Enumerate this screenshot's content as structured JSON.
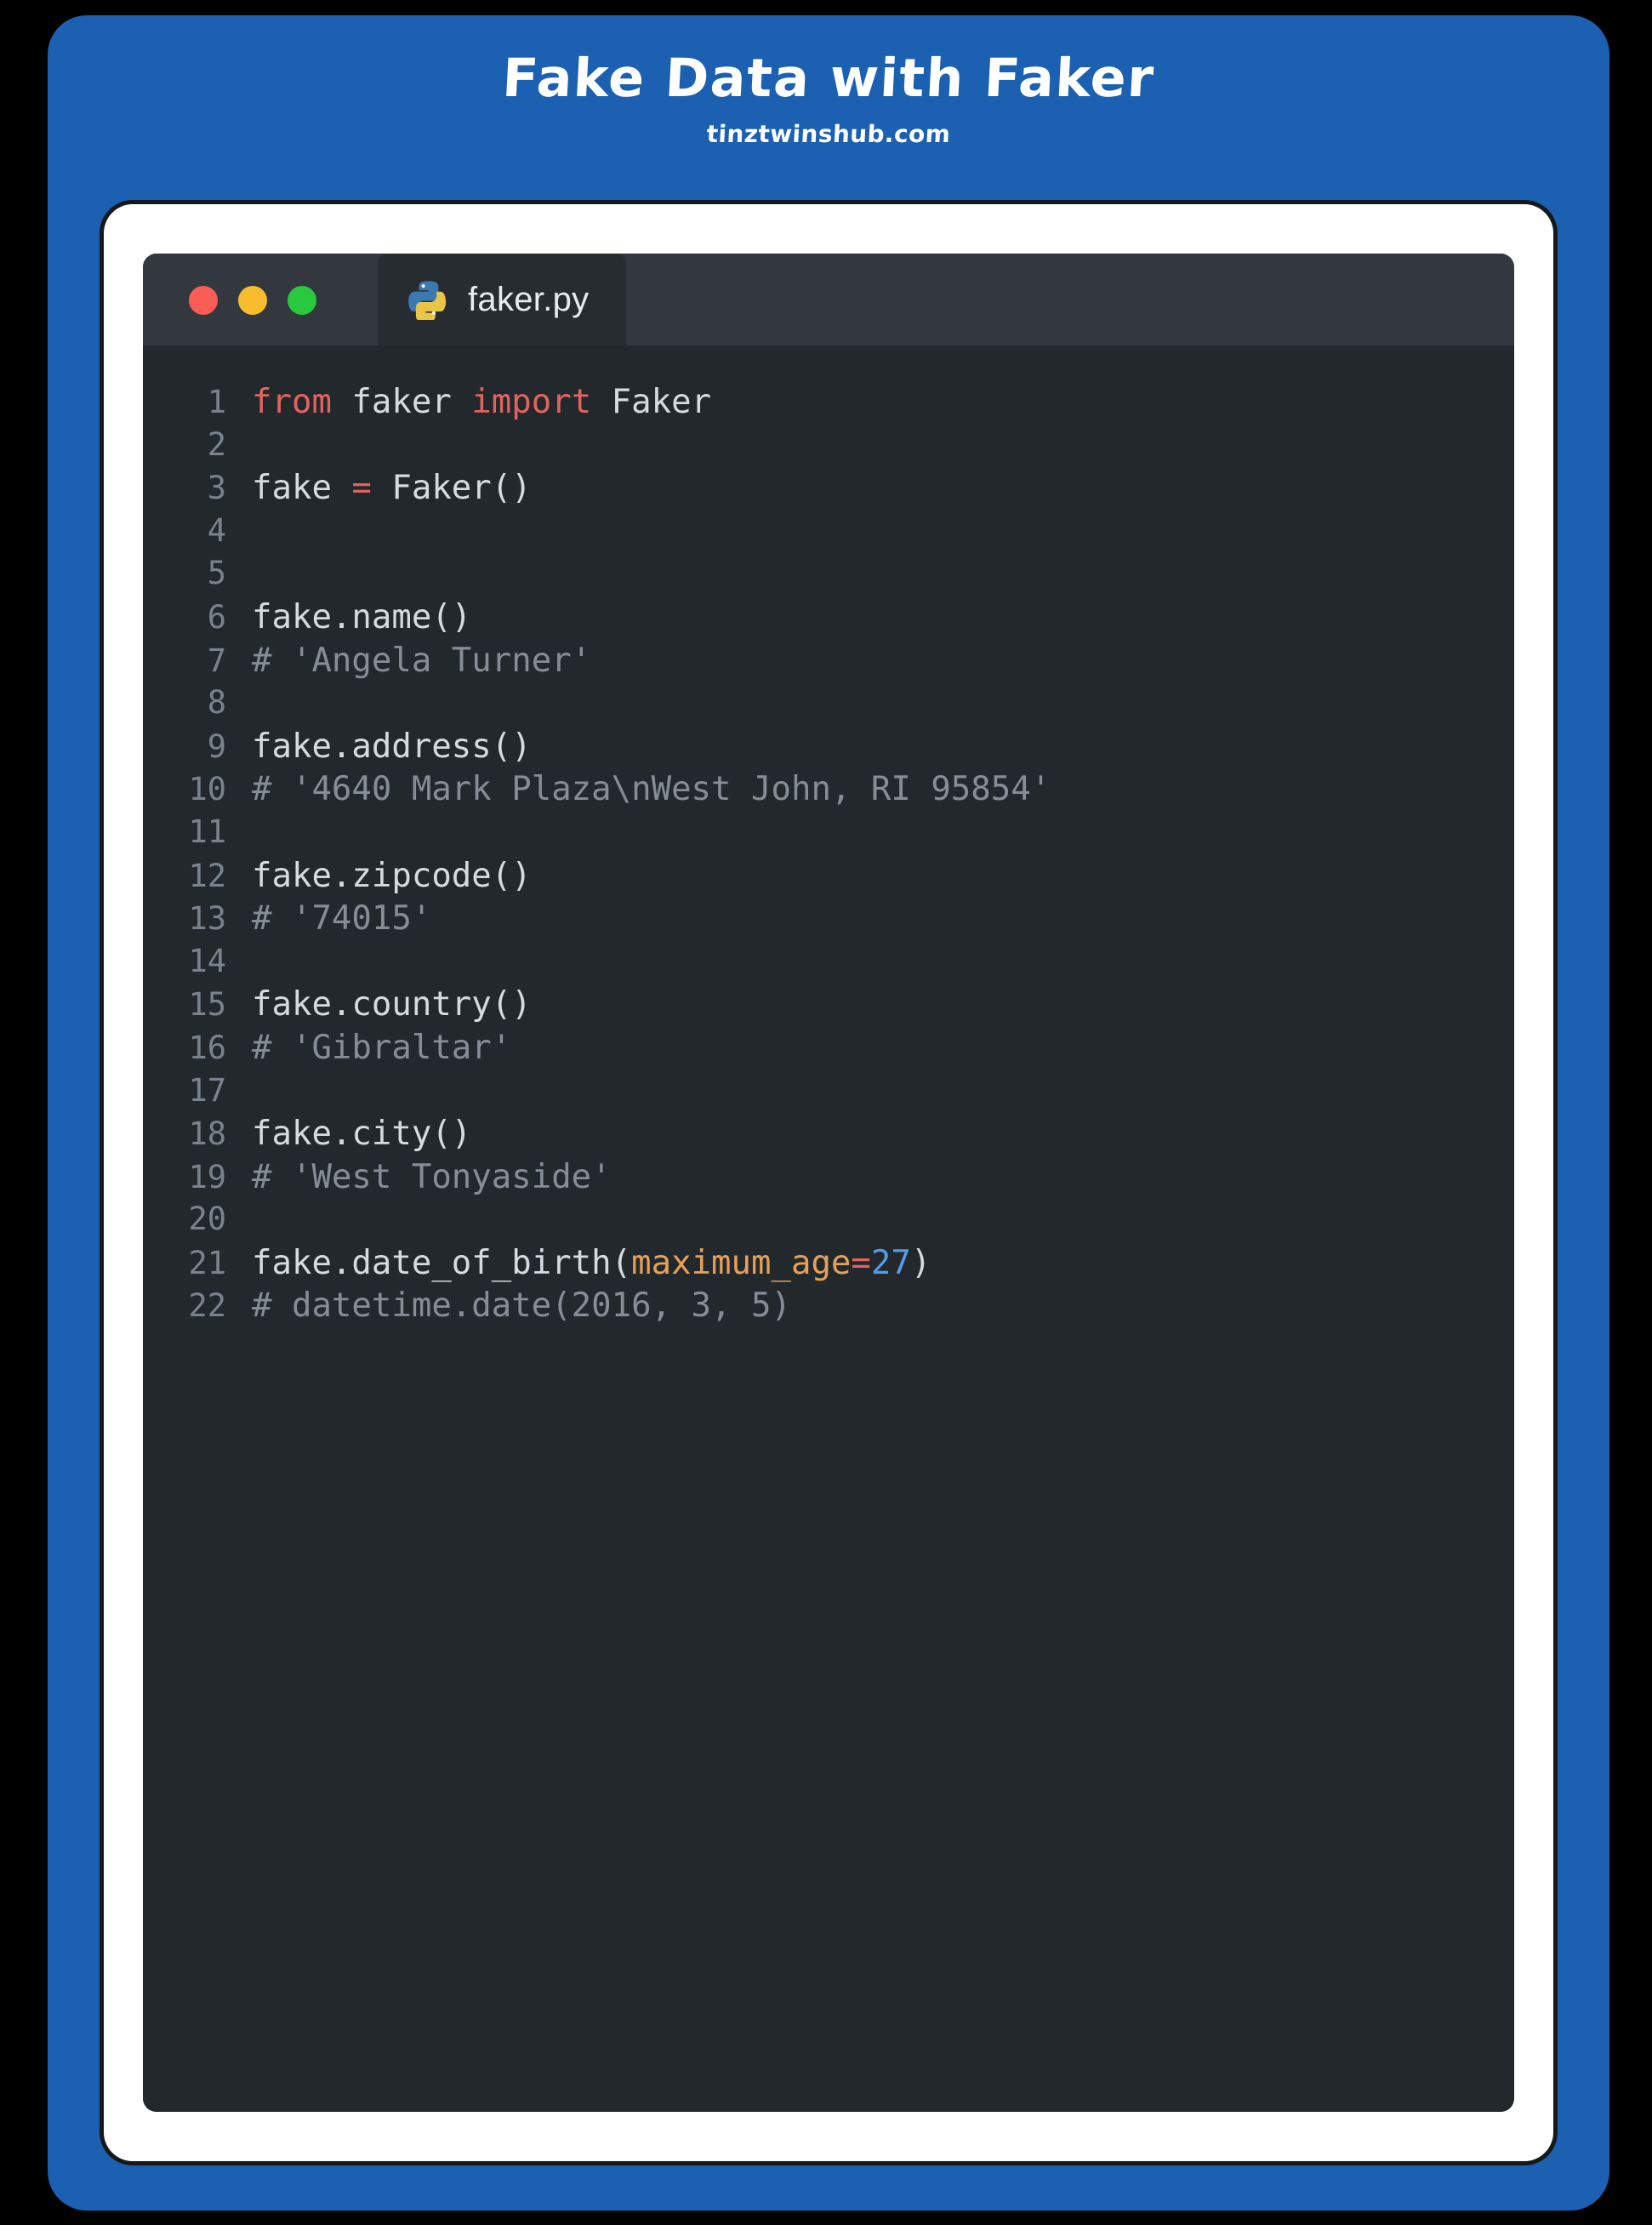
{
  "poster": {
    "title": "Fake Data with Faker",
    "subtitle": "tinztwinshub.com",
    "background_color": "#000000",
    "frame_color": "#1b60b1",
    "card_color": "#ffffff"
  },
  "window": {
    "titlebar_color": "#32383e",
    "body_color": "#23282c",
    "traffic_lights": [
      {
        "name": "close",
        "color": "#fa5d55"
      },
      {
        "name": "minimize",
        "color": "#f8bd2e"
      },
      {
        "name": "maximize",
        "color": "#28c83f"
      }
    ],
    "tab": {
      "label": "faker.py",
      "icon": "python-icon",
      "active": true
    }
  },
  "editor": {
    "language": "python",
    "syntax_colors": {
      "keyword": "#e0645f",
      "operator": "#e0645f",
      "comment": "#858e97",
      "kwarg": "#e6a158",
      "number": "#559bea",
      "plain": "#d6dbe0",
      "line_number": "#78838d"
    },
    "lines": [
      {
        "n": "1",
        "tokens": [
          {
            "t": "from",
            "c": "kw"
          },
          {
            "t": " faker ",
            "c": "plain"
          },
          {
            "t": "import",
            "c": "kw"
          },
          {
            "t": " Faker",
            "c": "plain"
          }
        ]
      },
      {
        "n": "2",
        "tokens": []
      },
      {
        "n": "3",
        "tokens": [
          {
            "t": "fake ",
            "c": "plain"
          },
          {
            "t": "=",
            "c": "op"
          },
          {
            "t": " Faker()",
            "c": "plain"
          }
        ]
      },
      {
        "n": "4",
        "tokens": []
      },
      {
        "n": "5",
        "tokens": []
      },
      {
        "n": "6",
        "tokens": [
          {
            "t": "fake.name()",
            "c": "plain"
          }
        ]
      },
      {
        "n": "7",
        "tokens": [
          {
            "t": "# 'Angela Turner'",
            "c": "comment"
          }
        ]
      },
      {
        "n": "8",
        "tokens": []
      },
      {
        "n": "9",
        "tokens": [
          {
            "t": "fake.address()",
            "c": "plain"
          }
        ]
      },
      {
        "n": "10",
        "tokens": [
          {
            "t": "# '4640 Mark Plaza\\nWest John, RI 95854'",
            "c": "comment"
          }
        ]
      },
      {
        "n": "11",
        "tokens": []
      },
      {
        "n": "12",
        "tokens": [
          {
            "t": "fake.zipcode()",
            "c": "plain"
          }
        ]
      },
      {
        "n": "13",
        "tokens": [
          {
            "t": "# '74015'",
            "c": "comment"
          }
        ]
      },
      {
        "n": "14",
        "tokens": []
      },
      {
        "n": "15",
        "tokens": [
          {
            "t": "fake.country()",
            "c": "plain"
          }
        ]
      },
      {
        "n": "16",
        "tokens": [
          {
            "t": "# 'Gibraltar'",
            "c": "comment"
          }
        ]
      },
      {
        "n": "17",
        "tokens": []
      },
      {
        "n": "18",
        "tokens": [
          {
            "t": "fake.city()",
            "c": "plain"
          }
        ]
      },
      {
        "n": "19",
        "tokens": [
          {
            "t": "# 'West Tonyaside'",
            "c": "comment"
          }
        ]
      },
      {
        "n": "20",
        "tokens": []
      },
      {
        "n": "21",
        "tokens": [
          {
            "t": "fake.date_of_birth(",
            "c": "plain"
          },
          {
            "t": "maximum_age",
            "c": "kwarg"
          },
          {
            "t": "=",
            "c": "op"
          },
          {
            "t": "27",
            "c": "num"
          },
          {
            "t": ")",
            "c": "plain"
          }
        ]
      },
      {
        "n": "22",
        "tokens": [
          {
            "t": "# datetime.date(2016, 3, 5)",
            "c": "comment"
          }
        ]
      }
    ]
  }
}
